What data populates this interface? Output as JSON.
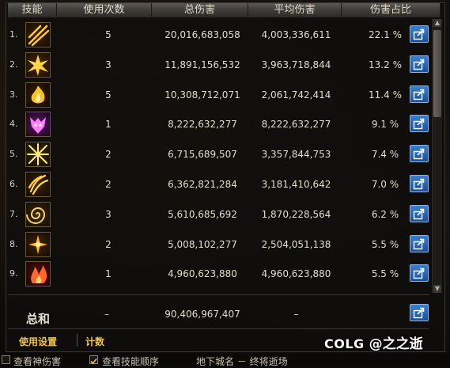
{
  "header": {
    "skill": "技能",
    "uses": "使用次数",
    "total": "总伤害",
    "avg": "平均伤害",
    "pct": "伤害占比"
  },
  "rows": [
    {
      "rank": "1.",
      "uses": "5",
      "total": "20,016,683,058",
      "avg": "4,003,336,611",
      "pct": "22.1 %",
      "icon": "golden-slash-skill-icon"
    },
    {
      "rank": "2.",
      "uses": "3",
      "total": "11,891,156,532",
      "avg": "3,963,718,844",
      "pct": "13.2 %",
      "icon": "golden-burst-skill-icon"
    },
    {
      "rank": "3.",
      "uses": "5",
      "total": "10,308,712,071",
      "avg": "2,061,742,414",
      "pct": "11.4 %",
      "icon": "golden-flame-skill-icon"
    },
    {
      "rank": "4.",
      "uses": "1",
      "total": "8,222,632,277",
      "avg": "8,222,632,277",
      "pct": "9.1 %",
      "icon": "purple-demon-skill-icon"
    },
    {
      "rank": "5.",
      "uses": "2",
      "total": "6,715,689,507",
      "avg": "3,357,844,753",
      "pct": "7.4 %",
      "icon": "lightning-cross-skill-icon"
    },
    {
      "rank": "6.",
      "uses": "2",
      "total": "6,362,821,284",
      "avg": "3,181,410,642",
      "pct": "7.0 %",
      "icon": "golden-claw-skill-icon"
    },
    {
      "rank": "7.",
      "uses": "3",
      "total": "5,610,685,692",
      "avg": "1,870,228,564",
      "pct": "6.2 %",
      "icon": "golden-swirl-skill-icon"
    },
    {
      "rank": "8.",
      "uses": "2",
      "total": "5,008,102,277",
      "avg": "2,504,051,138",
      "pct": "5.5 %",
      "icon": "golden-spikes-skill-icon"
    },
    {
      "rank": "9.",
      "uses": "1",
      "total": "4,960,623,880",
      "avg": "4,960,623,880",
      "pct": "5.5 %",
      "icon": "red-fire-skill-icon"
    }
  ],
  "total": {
    "label": "总和",
    "uses": "–",
    "sum": "90,406,967,407",
    "avg": "–"
  },
  "footer": {
    "settings": "使用设置",
    "count": "计数"
  },
  "watermark": {
    "brand": "COLG",
    "user": "@之之逝"
  },
  "bottombar": {
    "option1": "查看神伤害",
    "option2": "查看技能顺序",
    "option2_checked": true,
    "dungeon": "地下城名 － 终将逝场"
  },
  "colors": {
    "accent_gold": "#ebc34b",
    "share_button": "#2a66b3",
    "header_bg": "#4a4844"
  }
}
